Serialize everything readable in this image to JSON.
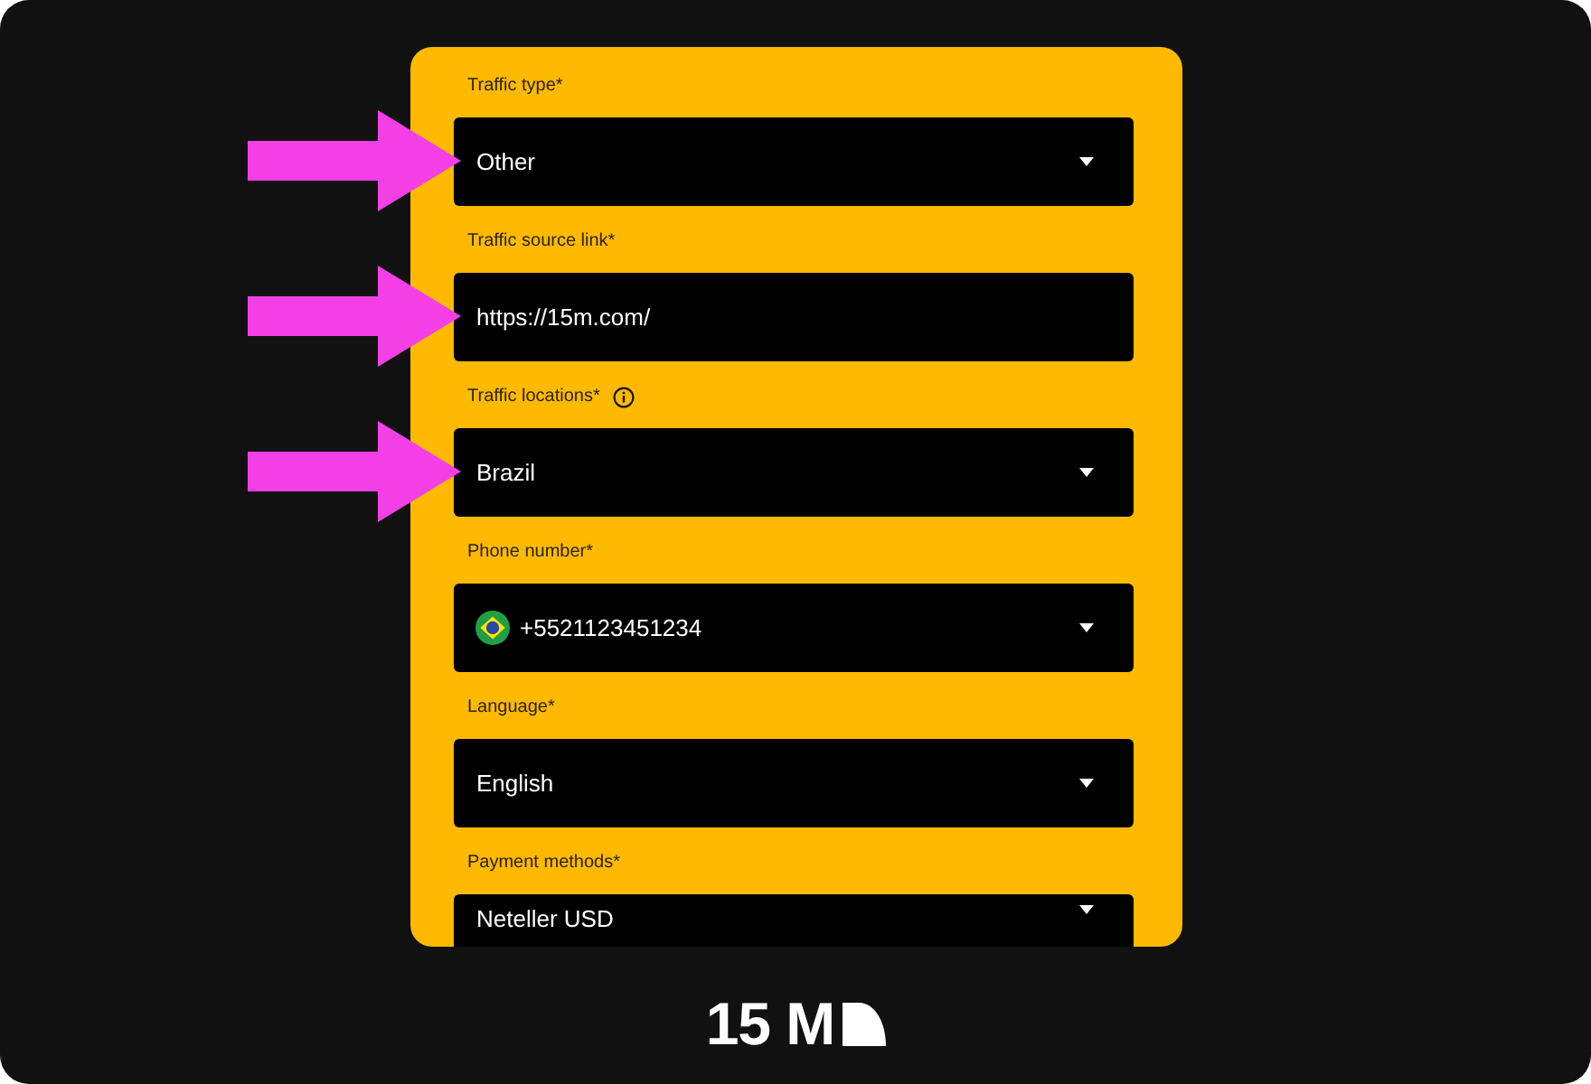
{
  "fields": [
    {
      "label": "Traffic type*",
      "info": false,
      "kind": "select",
      "value": "Other",
      "marked": true
    },
    {
      "label": "Traffic source link*",
      "info": false,
      "kind": "input",
      "value": "https://15m.com/",
      "marked": true
    },
    {
      "label": "Traffic locations*",
      "info": true,
      "kind": "select",
      "value": "Brazil",
      "marked": true
    },
    {
      "label": "Phone number*",
      "info": false,
      "kind": "phone",
      "value": "+5521123451234",
      "marked": false
    },
    {
      "label": "Language*",
      "info": false,
      "kind": "select",
      "value": "English",
      "marked": false
    },
    {
      "label": "Payment methods*",
      "info": false,
      "kind": "select",
      "value": "Neteller USD",
      "marked": false
    }
  ],
  "logo": {
    "text": "15 M"
  }
}
